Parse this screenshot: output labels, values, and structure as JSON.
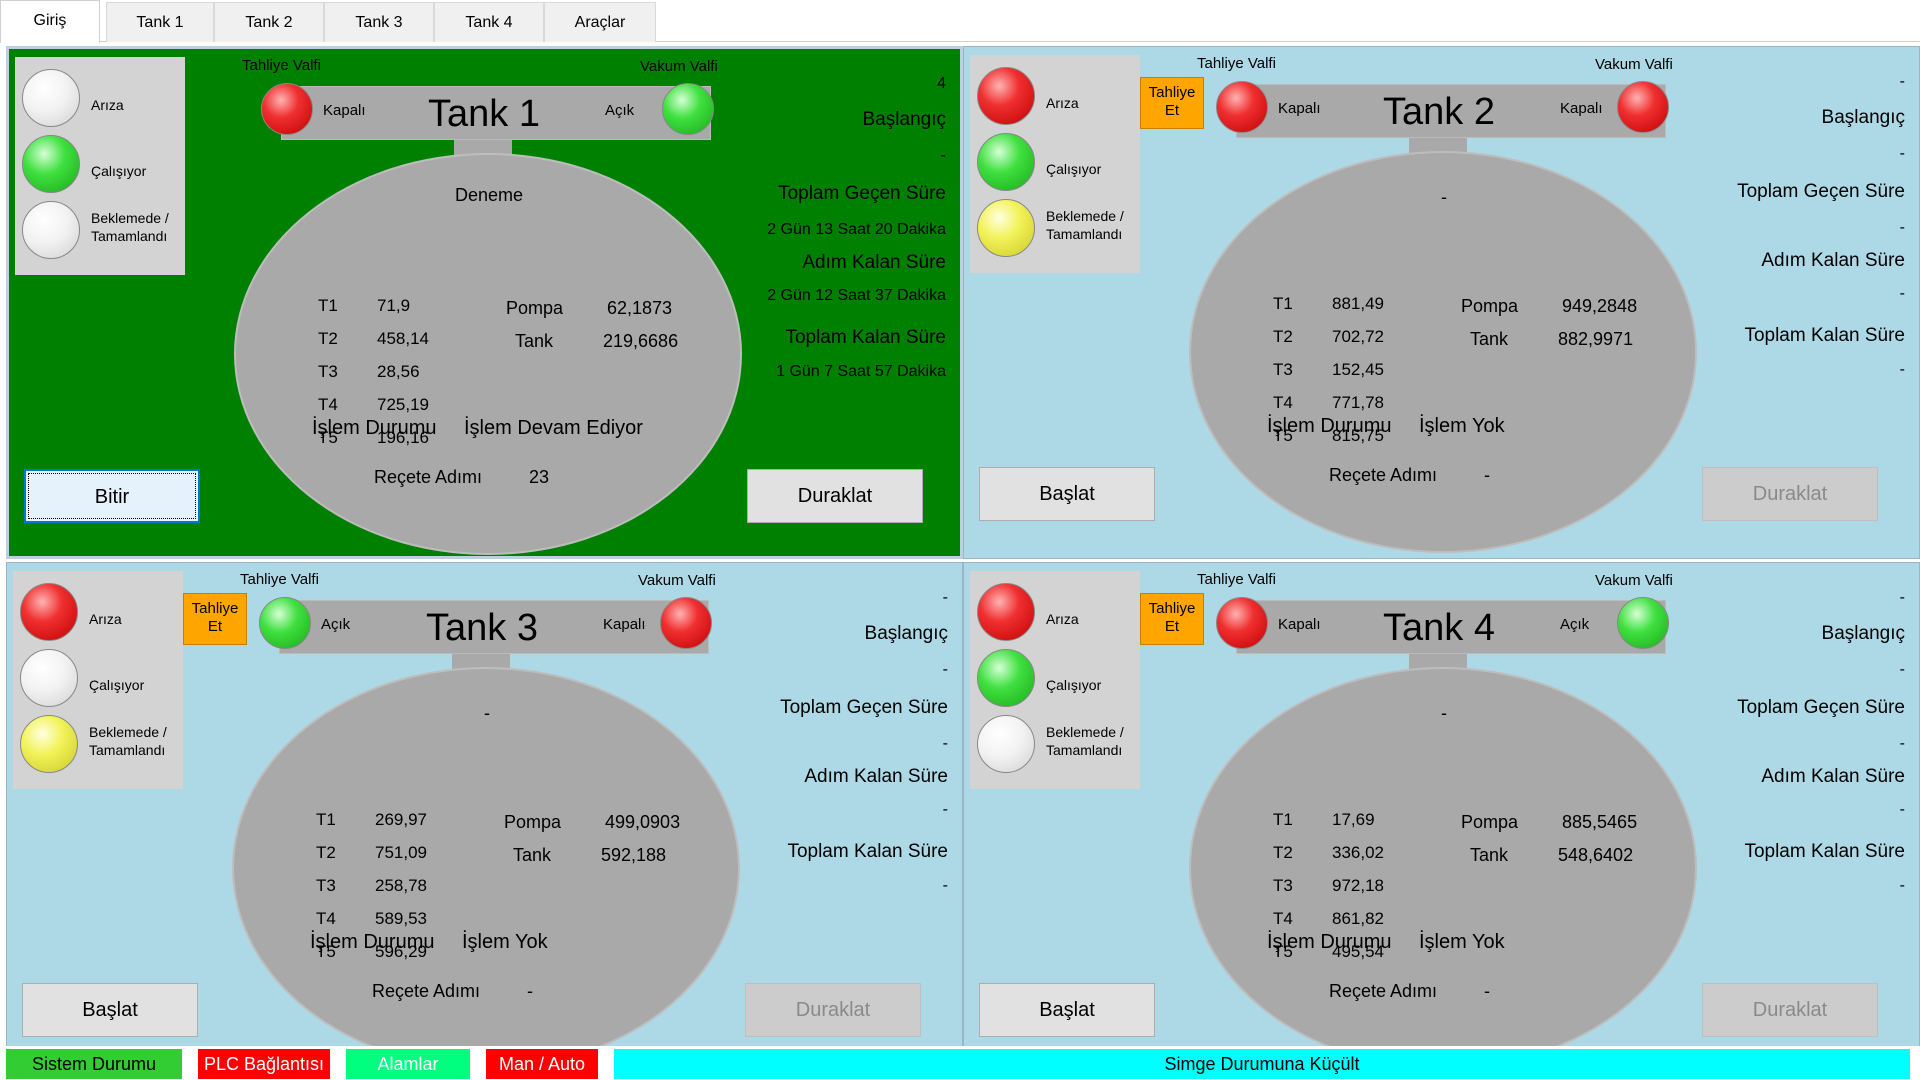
{
  "tabs": [
    {
      "label": "Giriş"
    },
    {
      "label": "Tank 1"
    },
    {
      "label": "Tank 2"
    },
    {
      "label": "Tank 3"
    },
    {
      "label": "Tank 4"
    },
    {
      "label": "Araçlar"
    }
  ],
  "common": {
    "legend": {
      "fault": "Arıza",
      "running": "Çalışıyor",
      "waiting_line1": "Beklemede /",
      "waiting_line2": "Tamamlandı"
    },
    "discharge_valve": "Tahliye Valfi",
    "vacuum_valve": "Vakum Valfi",
    "discharge_button_line1": "Tahliye",
    "discharge_button_line2": "Et",
    "pump_label": "Pompa",
    "tank_label": "Tank",
    "status_label": "İşlem Durumu",
    "recipe_step_label": "Reçete Adımı",
    "start_label": "Başlangıç",
    "elapsed_label": "Toplam Geçen Süre",
    "step_remaining_label": "Adım Kalan Süre",
    "total_remaining_label": "Toplam Kalan Süre",
    "pause_button": "Duraklat"
  },
  "tanks": [
    {
      "title": "Tank 1",
      "leds": {
        "fault": "off",
        "running": "green",
        "waiting": "off"
      },
      "discharge_state": "Kapalı",
      "discharge_led": "red",
      "vacuum_state": "Açık",
      "vacuum_led": "green",
      "recipe_name": "Deneme",
      "temps": [
        {
          "name": "T1",
          "value": "71,9"
        },
        {
          "name": "T2",
          "value": "458,14"
        },
        {
          "name": "T3",
          "value": "28,56"
        },
        {
          "name": "T4",
          "value": "725,19"
        },
        {
          "name": "T5",
          "value": "196,16"
        }
      ],
      "pump_value": "62,1873",
      "tank_value": "219,6686",
      "status": "İşlem Devam Ediyor",
      "recipe_step": "23",
      "start_value": "4",
      "elapsed": "-",
      "step_remaining": "2 Gün 13 Saat 20 Dakika",
      "total_remaining": "2 Gün 12 Saat 37 Dakika",
      "last_value": "1 Gün 7 Saat 57 Dakika",
      "start_button": "Bitir"
    },
    {
      "title": "Tank 2",
      "leds": {
        "fault": "red",
        "running": "green",
        "waiting": "yellow"
      },
      "discharge_state": "Kapalı",
      "discharge_led": "red",
      "vacuum_state": "Kapalı",
      "vacuum_led": "red",
      "recipe_name": "-",
      "temps": [
        {
          "name": "T1",
          "value": "881,49"
        },
        {
          "name": "T2",
          "value": "702,72"
        },
        {
          "name": "T3",
          "value": "152,45"
        },
        {
          "name": "T4",
          "value": "771,78"
        },
        {
          "name": "T5",
          "value": "815,75"
        }
      ],
      "pump_value": "949,2848",
      "tank_value": "882,9971",
      "status": "İşlem Yok",
      "recipe_step": "-",
      "start_value": "-",
      "elapsed": "-",
      "step_remaining": "-",
      "total_remaining": "-",
      "last_value": "-",
      "start_button": "Başlat"
    },
    {
      "title": "Tank 3",
      "leds": {
        "fault": "red",
        "running": "off",
        "waiting": "yellow"
      },
      "discharge_state": "Açık",
      "discharge_led": "green",
      "vacuum_state": "Kapalı",
      "vacuum_led": "red",
      "recipe_name": "-",
      "temps": [
        {
          "name": "T1",
          "value": "269,97"
        },
        {
          "name": "T2",
          "value": "751,09"
        },
        {
          "name": "T3",
          "value": "258,78"
        },
        {
          "name": "T4",
          "value": "589,53"
        },
        {
          "name": "T5",
          "value": "596,29"
        }
      ],
      "pump_value": "499,0903",
      "tank_value": "592,188",
      "status": "İşlem Yok",
      "recipe_step": "-",
      "start_value": "-",
      "elapsed": "-",
      "step_remaining": "-",
      "total_remaining": "-",
      "last_value": "-",
      "start_button": "Başlat"
    },
    {
      "title": "Tank 4",
      "leds": {
        "fault": "red",
        "running": "green",
        "waiting": "off"
      },
      "discharge_state": "Kapalı",
      "discharge_led": "red",
      "vacuum_state": "Açık",
      "vacuum_led": "green",
      "recipe_name": "-",
      "temps": [
        {
          "name": "T1",
          "value": "17,69"
        },
        {
          "name": "T2",
          "value": "336,02"
        },
        {
          "name": "T3",
          "value": "972,18"
        },
        {
          "name": "T4",
          "value": "861,82"
        },
        {
          "name": "T5",
          "value": "495,54"
        }
      ],
      "pump_value": "885,5465",
      "tank_value": "548,6402",
      "status": "İşlem Yok",
      "recipe_step": "-",
      "start_value": "-",
      "elapsed": "-",
      "step_remaining": "-",
      "total_remaining": "-",
      "last_value": "-",
      "start_button": "Başlat"
    }
  ],
  "bottom_bar": {
    "system_status": "Sistem Durumu",
    "plc_connection": "PLC Bağlantısı",
    "alarms": "Alamlar",
    "man_auto": "Man / Auto",
    "minimize": "Simge Durumuna Küçült"
  },
  "colors": {
    "running_panel": "#008000",
    "idle_panel": "#add8e6",
    "tank_gray": "#a9a9a9",
    "discharge_orange": "#ffa500",
    "system_status_green": "#32cd32",
    "plc_red": "#ff0000",
    "alarms_green": "#00ff7f",
    "man_auto_red": "#ff0000",
    "minimize_cyan": "#00ffff"
  }
}
